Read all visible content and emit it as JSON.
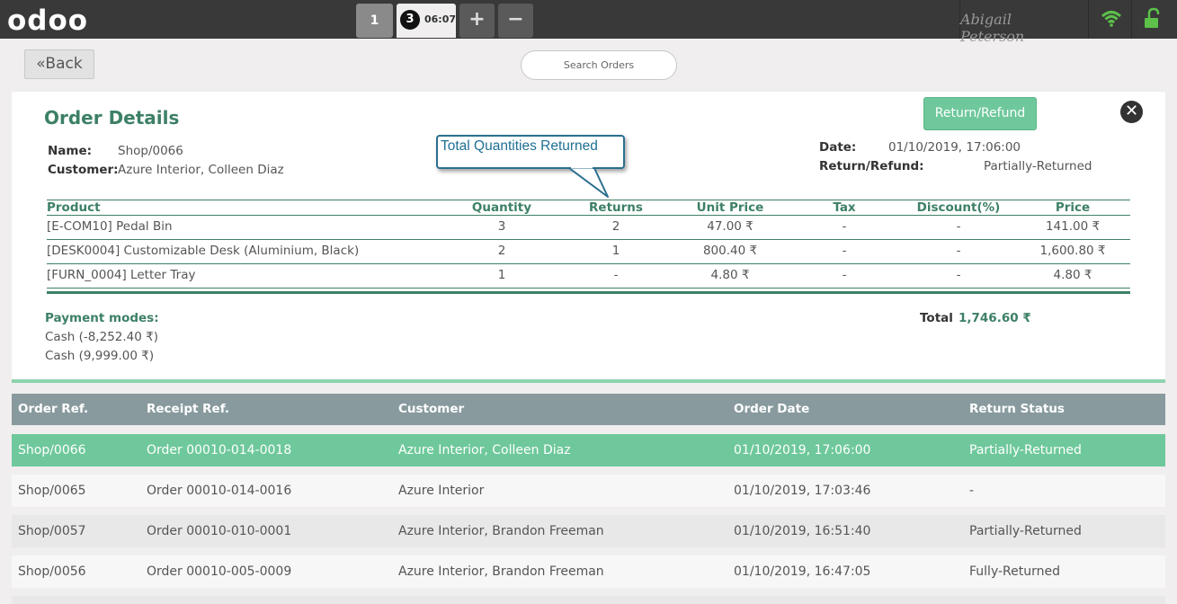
{
  "topbar": {
    "logo": "odoo",
    "tabs": [
      {
        "number": "1"
      },
      {
        "number": "3",
        "time": "06:07"
      }
    ],
    "add_label": "+",
    "remove_label": "−",
    "user": "Abigail Peterson",
    "colors": {
      "bar": "#393939",
      "wifi": "#5cc04a",
      "lock": "#5cc04a"
    }
  },
  "controls": {
    "back_label": "Back",
    "search_placeholder": "Search Orders"
  },
  "details": {
    "title": "Order Details",
    "return_refund_label": "Return/Refund",
    "name_label": "Name:",
    "name_value": "Shop/0066",
    "customer_label": "Customer:",
    "customer_value": "Azure Interior, Colleen Diaz",
    "date_label": "Date:",
    "date_value": "01/10/2019, 17:06:00",
    "status_label": "Return/Refund:",
    "status_value": "Partially-Returned",
    "callout": "Total Quantities Returned",
    "columns": [
      "Product",
      "Quantity",
      "Returns",
      "Unit Price",
      "Tax",
      "Discount(%)",
      "Price"
    ],
    "lines": [
      {
        "product": "[E-COM10] Pedal Bin",
        "qty": "3",
        "returns": "2",
        "unit_price": "47.00 ₹",
        "tax": "-",
        "discount": "-",
        "price": "141.00 ₹"
      },
      {
        "product": "[DESK0004] Customizable Desk (Aluminium, Black)",
        "qty": "2",
        "returns": "1",
        "unit_price": "800.40 ₹",
        "tax": "-",
        "discount": "-",
        "price": "1,600.80 ₹"
      },
      {
        "product": "[FURN_0004] Letter Tray",
        "qty": "1",
        "returns": "-",
        "unit_price": "4.80 ₹",
        "tax": "-",
        "discount": "-",
        "price": "4.80 ₹"
      }
    ],
    "payment_label": "Payment modes:",
    "payments": [
      "Cash (-8,252.40 ₹)",
      "Cash (9,999.00 ₹)"
    ],
    "total_label": "Total",
    "total_value": "1,746.60 ₹",
    "colors": {
      "accent": "#3d8066",
      "button": "#6ec89b"
    }
  },
  "orders": {
    "columns": [
      "Order Ref.",
      "Receipt Ref.",
      "Customer",
      "Order Date",
      "Return Status"
    ],
    "rows": [
      {
        "ref": "Shop/0066",
        "receipt": "Order 00010-014-0018",
        "customer": "Azure Interior, Colleen Diaz",
        "date": "01/10/2019, 17:06:00",
        "status": "Partially-Returned"
      },
      {
        "ref": "Shop/0065",
        "receipt": "Order 00010-014-0016",
        "customer": "Azure Interior",
        "date": "01/10/2019, 17:03:46",
        "status": "-"
      },
      {
        "ref": "Shop/0057",
        "receipt": "Order 00010-010-0001",
        "customer": "Azure Interior, Brandon Freeman",
        "date": "01/10/2019, 16:51:40",
        "status": "Partially-Returned"
      },
      {
        "ref": "Shop/0056",
        "receipt": "Order 00010-005-0009",
        "customer": "Azure Interior, Brandon Freeman",
        "date": "01/10/2019, 16:47:05",
        "status": "Fully-Returned"
      }
    ],
    "colors": {
      "header": "#889a9e",
      "selected": "#6ec89b"
    }
  }
}
